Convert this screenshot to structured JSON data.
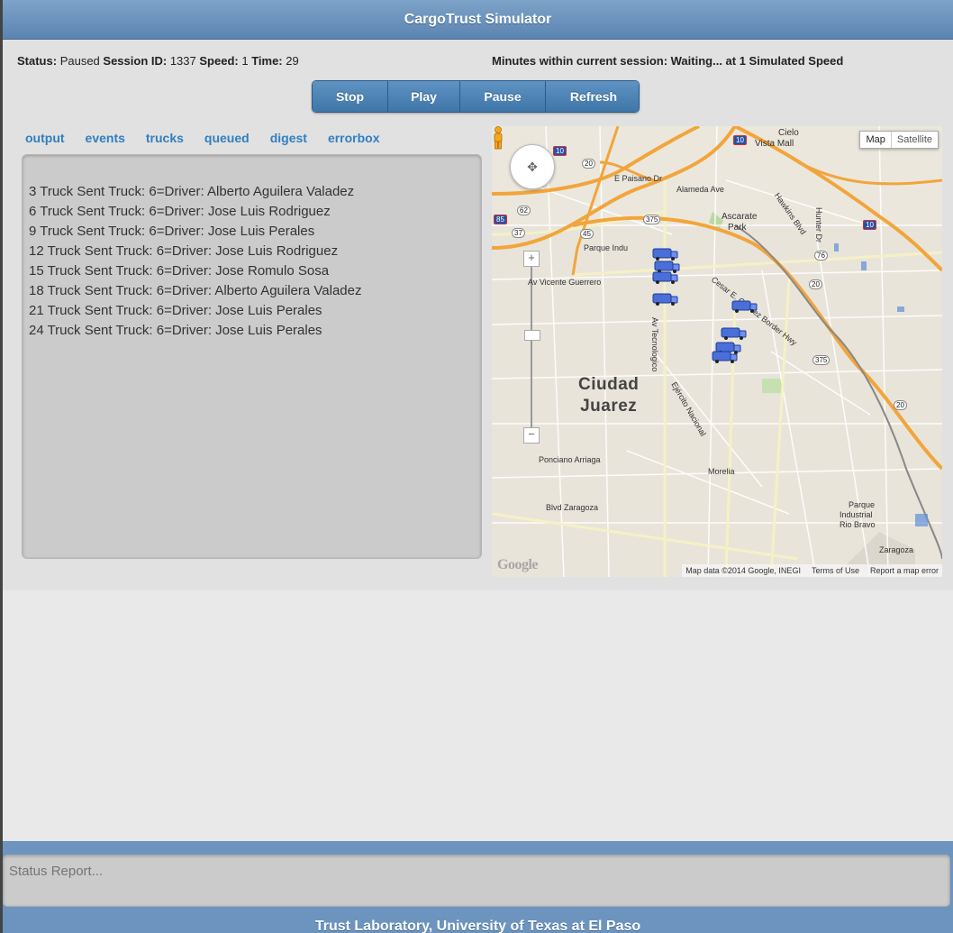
{
  "app": {
    "title": "CargoTrust Simulator"
  },
  "status": {
    "status_label": "Status:",
    "status_value": "Paused",
    "session_label": "Session ID:",
    "session_value": "1337",
    "speed_label": "Speed:",
    "speed_value": "1",
    "time_label": "Time:",
    "time_value": "29",
    "minutes_text": "Minutes within current session: Waiting... at 1 Simulated Speed"
  },
  "controls": {
    "stop": "Stop",
    "play": "Play",
    "pause": "Pause",
    "refresh": "Refresh"
  },
  "tabs": [
    "output",
    "events",
    "trucks",
    "queued",
    "digest",
    "errorbox"
  ],
  "output_lines": [
    "3 Truck Sent Truck: 6=Driver: Alberto Aguilera Valadez",
    "6 Truck Sent Truck: 6=Driver: Jose Luis Rodriguez",
    "9 Truck Sent Truck: 6=Driver: Jose Luis Perales",
    "12 Truck Sent Truck: 6=Driver: Jose Luis Rodriguez",
    "15 Truck Sent Truck: 6=Driver: Jose Romulo Sosa",
    "18 Truck Sent Truck: 6=Driver: Alberto Aguilera Valadez",
    "21 Truck Sent Truck: 6=Driver: Jose Luis Perales",
    "24 Truck Sent Truck: 6=Driver: Jose Luis Perales"
  ],
  "map": {
    "type_map": "Map",
    "type_satellite": "Satellite",
    "city_line1": "Ciudad",
    "city_line2": "Juarez",
    "labels": {
      "cielo": "Cielo",
      "vista_mall": "Vista Mall",
      "paisano": "E Paisano Dr",
      "alameda": "Alameda Ave",
      "ascarate": "Ascarate",
      "park": "Park",
      "parque_indu": "Parque Indu",
      "av_vicente": "Av Vicente Guerrero",
      "chavez": "Cesar E. Chavez Border Hwy",
      "ejercito": "Ejército Nacional",
      "tecnologico": "Av Tecnologico",
      "poniano": "Ponciano Arriaga",
      "blvd_zaragoza": "Blvd Zaragoza",
      "morelia": "Morelia",
      "parque_rio": "Parque",
      "parque_rio2": "Industrial",
      "parque_rio3": "Rio Bravo",
      "zaragoza": "Zaragoza",
      "hawkins": "Hawkins Blvd",
      "hunter": "Hunter Dr"
    },
    "shields": {
      "i10a": "10",
      "i10b": "10",
      "i10c": "10",
      "r20a": "20",
      "r20b": "20",
      "r20c": "20",
      "r375a": "375",
      "r375b": "375",
      "r85": "85",
      "r37": "37",
      "r45": "45",
      "r76": "76",
      "r62": "62"
    },
    "attribution": {
      "data": "Map data ©2014 Google, INEGI",
      "terms": "Terms of Use",
      "report": "Report a map error"
    },
    "logo": "Google"
  },
  "status_report": {
    "placeholder": "Status Report..."
  },
  "footer": {
    "text": "Trust Laboratory, University of Texas at El Paso"
  },
  "colors": {
    "header": "#6b93bd",
    "button": "#4c82b5",
    "tab_link": "#2f7fc0",
    "highway": "#f2a53b"
  }
}
